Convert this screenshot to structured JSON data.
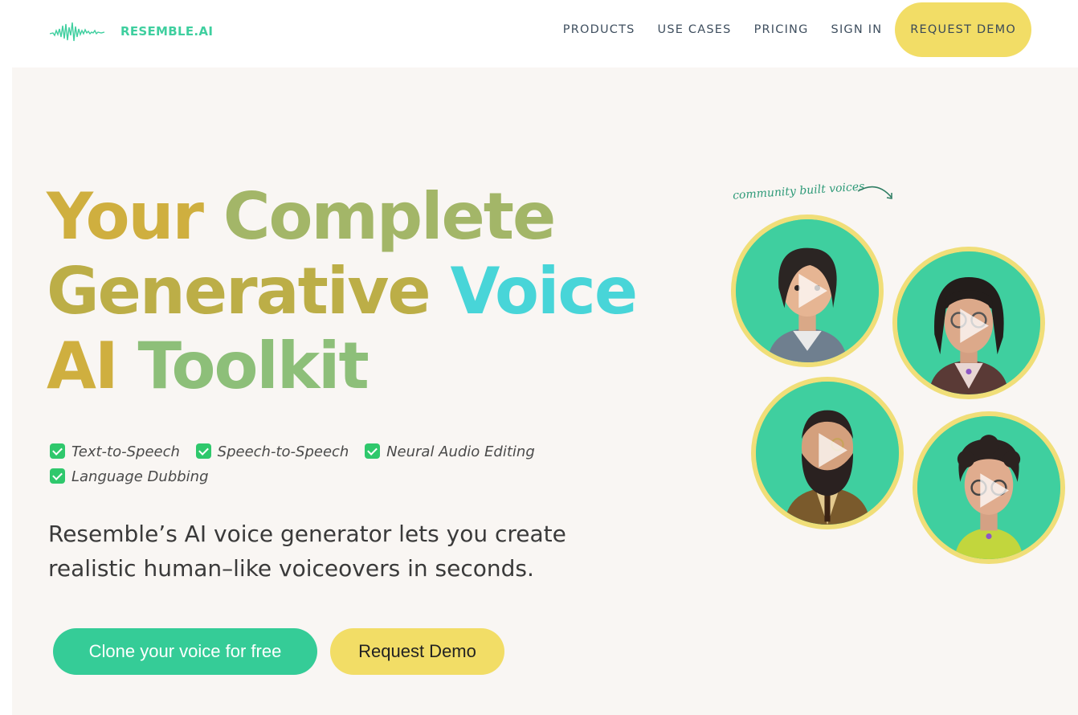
{
  "nav": {
    "brand": "RESEMBLE.AI",
    "links": [
      "PRODUCTS",
      "USE CASES",
      "PRICING",
      "SIGN IN"
    ],
    "cta": "REQUEST DEMO"
  },
  "hero": {
    "headline": {
      "line1": [
        "Your ",
        "Complete"
      ],
      "line2": [
        "Generative ",
        "Voice"
      ],
      "line3": [
        "AI ",
        "Toolkit"
      ]
    },
    "features": [
      "Text-to-Speech",
      "Speech-to-Speech",
      "Neural Audio Editing",
      "Language Dubbing"
    ],
    "subtitle": "Resemble’s AI voice generator lets you create realistic human–like voiceovers in seconds.",
    "primary_button": "Clone your voice for free",
    "secondary_button": "Request Demo"
  },
  "community": {
    "label": "community built voices",
    "avatars": [
      "voice-avatar-1",
      "voice-avatar-2",
      "voice-avatar-3",
      "voice-avatar-4"
    ]
  },
  "colors": {
    "accent_green": "#35cc97",
    "accent_yellow": "#f2dd66",
    "hero_bg": "#f9f6f3",
    "check_green": "#2fc86c"
  }
}
